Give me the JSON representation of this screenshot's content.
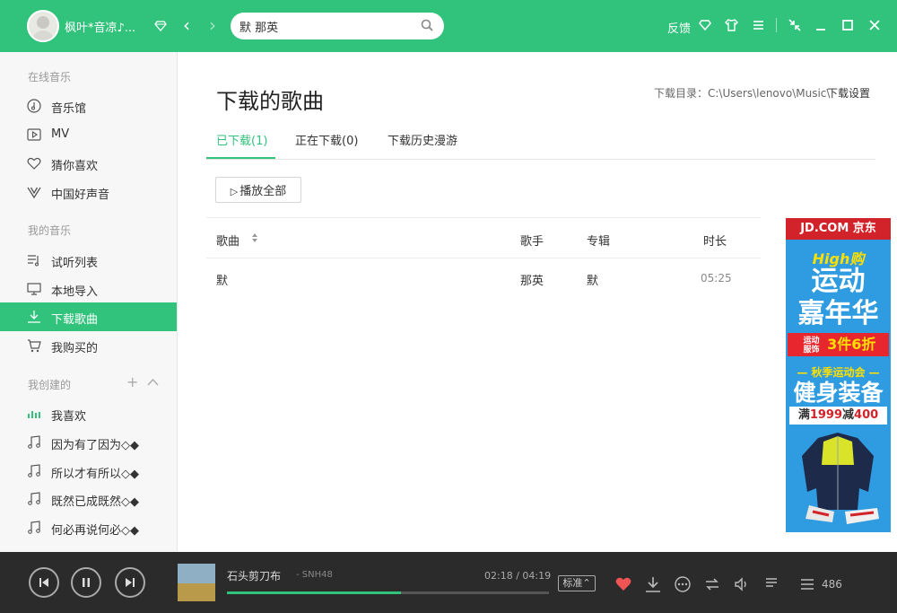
{
  "header": {
    "username": "枫叶*音凉♪...",
    "search_value": "默 那英",
    "feedback_label": "反馈"
  },
  "sidebar": {
    "online_title": "在线音乐",
    "online_items": [
      {
        "label": "音乐馆",
        "icon": "music-disc-icon"
      },
      {
        "label": "MV",
        "icon": "mv-play-icon"
      },
      {
        "label": "猜你喜欢",
        "icon": "heart-icon"
      },
      {
        "label": "中国好声音",
        "icon": "voice-v-icon"
      }
    ],
    "my_title": "我的音乐",
    "my_items": [
      {
        "label": "试听列表",
        "icon": "playlist-icon"
      },
      {
        "label": "本地导入",
        "icon": "monitor-icon"
      },
      {
        "label": "下载歌曲",
        "icon": "download-icon"
      },
      {
        "label": "我购买的",
        "icon": "cart-icon"
      }
    ],
    "created_title": "我创建的",
    "created_items": [
      {
        "label": "我喜欢",
        "icon": "equalizer-icon"
      },
      {
        "label": "因为有了因为◇◆",
        "icon": "music-note-icon"
      },
      {
        "label": "所以才有所以◇◆",
        "icon": "music-note-icon"
      },
      {
        "label": "既然已成既然◇◆",
        "icon": "music-note-icon"
      },
      {
        "label": "何必再说何必◇◆",
        "icon": "music-note-icon"
      }
    ]
  },
  "main": {
    "title": "下载的歌曲",
    "download_dir": "下载目录：C:\\Users\\lenovo\\Music\\",
    "download_settings": "下载设置",
    "tabs": [
      {
        "label": "已下载(1)"
      },
      {
        "label": "正在下载(0)"
      },
      {
        "label": "下载历史漫游"
      }
    ],
    "play_all": "播放全部",
    "columns": {
      "song": "歌曲",
      "artist": "歌手",
      "album": "专辑",
      "duration": "时长"
    },
    "rows": [
      {
        "song": "默",
        "artist": "那英",
        "album": "默",
        "duration": "05:25"
      }
    ]
  },
  "ad": {
    "brand": "JD.COM 京东",
    "line1": "High购",
    "line2": "运动",
    "line3": "嘉年华",
    "band_left": "运动服饰",
    "band_right": "3件6折",
    "line4": "— 秋季运动会 —",
    "line5": "健身装备",
    "promo_prefix": "满",
    "promo_amount1": "1999",
    "promo_mid": "减",
    "promo_amount2": "400"
  },
  "player": {
    "song_title": "石头剪刀布",
    "artist": "- SNH48",
    "time": "02:18 / 04:19",
    "progress": 0.54,
    "quality": "标准",
    "count": "486"
  },
  "colors": {
    "accent": "#31c27c",
    "player_bg": "#2b2b2b",
    "ad_red": "#d3232a",
    "ad_blue": "#2f9be0"
  }
}
